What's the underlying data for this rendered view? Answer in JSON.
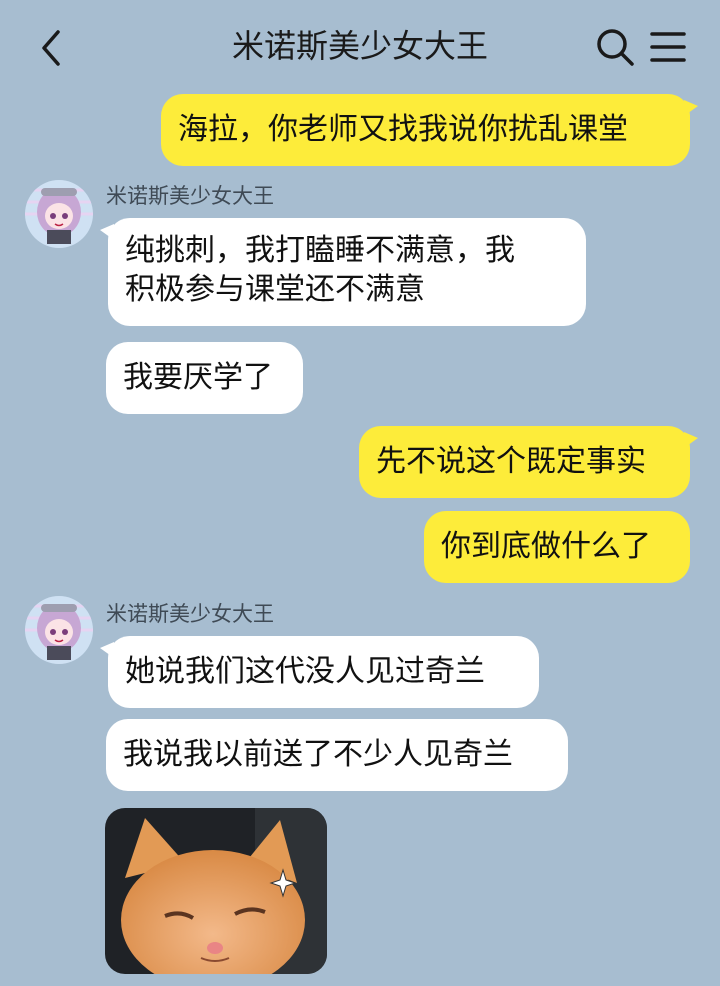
{
  "header": {
    "title": "米诺斯美少女大王"
  },
  "messages": {
    "m1": "海拉，你老师又找我说你扰乱课堂",
    "sender1": "米诺斯美少女大王",
    "m2_line1": "纯挑刺，我打瞌睡不满意，我",
    "m2_line2": "积极参与课堂还不满意",
    "m3": "我要厌学了",
    "m4": "先不说这个既定事实",
    "m5": "你到底做什么了",
    "sender2": "米诺斯美少女大王",
    "m6": "她说我们这代没人见过奇兰",
    "m7": "我说我以前送了不少人见奇兰"
  },
  "colors": {
    "background": "#a7bdd0",
    "incoming_bubble": "#ffffff",
    "outgoing_bubble": "#fdec3a"
  }
}
